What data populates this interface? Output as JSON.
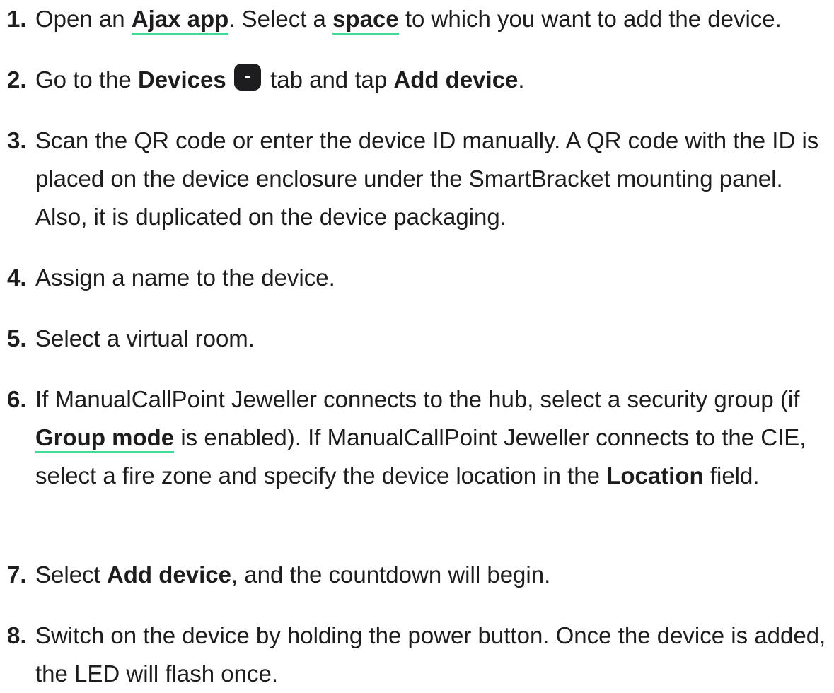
{
  "steps": [
    {
      "number": "1.",
      "parts": {
        "a": "Open an ",
        "link1": "Ajax app",
        "b": ". Select a ",
        "link2": "space",
        "c": " to which you want to add the device."
      }
    },
    {
      "number": "2.",
      "parts": {
        "a": "Go to the ",
        "bold1": "Devices",
        "icon": "devices-tab-icon",
        "b": " tab and tap ",
        "bold2": "Add device",
        "c": "."
      }
    },
    {
      "number": "3.",
      "parts": {
        "a": "Scan the QR code or enter the device ID manually. A QR code with the ID is placed on the device enclosure under the SmartBracket mounting panel. Also, it is duplicated on the device packaging."
      }
    },
    {
      "number": "4.",
      "parts": {
        "a": "Assign a name to the device."
      }
    },
    {
      "number": "5.",
      "parts": {
        "a": "Select a virtual room."
      }
    },
    {
      "number": "6.",
      "parts": {
        "a": "If ManualCallPoint Jeweller connects to the hub, select a security group (if ",
        "link1": "Group mode",
        "b": " is enabled). If ManualCallPoint Jeweller connects to the CIE, select a fire zone and specify the device location in the ",
        "bold1": "Location",
        "c": " field."
      }
    },
    {
      "number": "7.",
      "parts": {
        "a": "Select ",
        "bold1": "Add device",
        "b": ", and the countdown will begin."
      }
    },
    {
      "number": "8.",
      "parts": {
        "a": "Switch on the device by holding the power button. Once the device is added, the LED will flash once."
      }
    }
  ],
  "colors": {
    "text": "#1d1d1f",
    "link_underline": "#3ddc97",
    "background": "#ffffff"
  }
}
